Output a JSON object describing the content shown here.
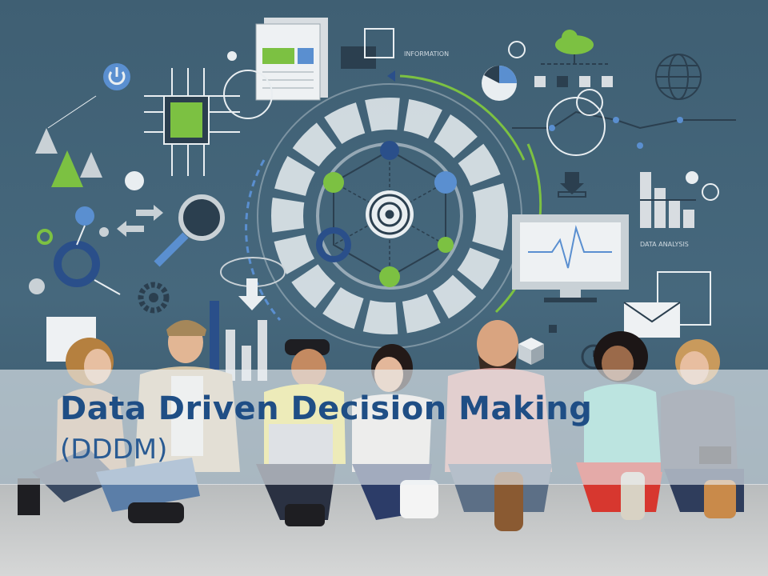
{
  "slide": {
    "title": "Data Driven Decision Making",
    "subtitle": "(DDDM)"
  },
  "mural": {
    "labels": {
      "information": "INFORMATION",
      "data_analysis": "DATA ANALYSIS"
    },
    "icons": [
      "power-icon",
      "chip-icon",
      "document-icon",
      "folder-icon",
      "cloud-icon",
      "pie-chart-icon",
      "globe-icon",
      "gauge-ring-icon",
      "network-hexagon-icon",
      "target-icon",
      "download-icon",
      "bar-chart-icon",
      "monitor-pulse-icon",
      "envelope-icon",
      "magnifier-icon",
      "gear-icon",
      "arrows-icon",
      "triangle-icon",
      "cube-icon",
      "clock-icon"
    ]
  },
  "photo": {
    "subject": "seven people sitting on the floor against the mural",
    "people_count": 7
  },
  "colors": {
    "wall": "#46687d",
    "mural_white": "#e9eef1",
    "mural_green": "#7cc142",
    "mural_blue": "#5a8fd0",
    "title_blue": "#1f4e85",
    "banner": "rgba(236,240,243,0.62)"
  }
}
